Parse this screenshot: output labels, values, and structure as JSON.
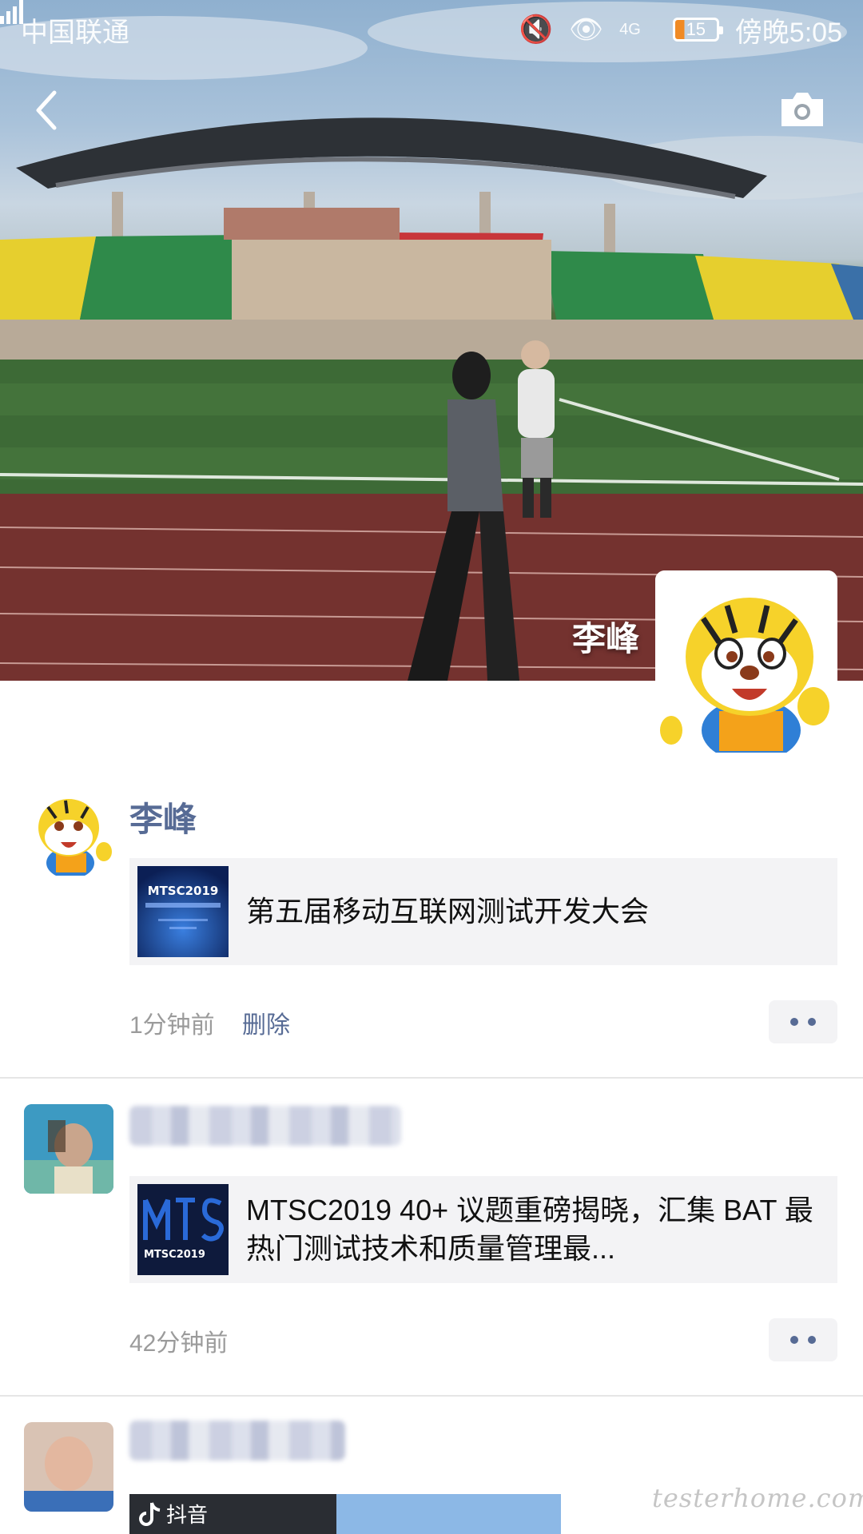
{
  "status_bar": {
    "carrier": "中国联通",
    "network": "4G",
    "battery": "15",
    "time": "傍晚5:05"
  },
  "header": {
    "back_icon": "chevron-left-icon",
    "camera_icon": "camera-icon"
  },
  "profile": {
    "name": "李峰"
  },
  "posts": [
    {
      "author": "李峰",
      "link_thumb_text": "MTSC2019",
      "link_title": "第五届移动互联网测试开发大会",
      "time": "1分钟前",
      "delete_label": "删除"
    },
    {
      "author": "",
      "link_thumb_text": "MTSC2019",
      "link_title": "MTSC2019 40+ 议题重磅揭晓，汇集 BAT 最热门测试技术和质量管理最...",
      "time": "42分钟前"
    },
    {
      "author": "",
      "app_label": "抖音"
    }
  ],
  "watermark": "testerhome.com",
  "colors": {
    "link_blue": "#576b95",
    "card_bg": "#f3f3f5",
    "time_gray": "#9b9b9b"
  }
}
